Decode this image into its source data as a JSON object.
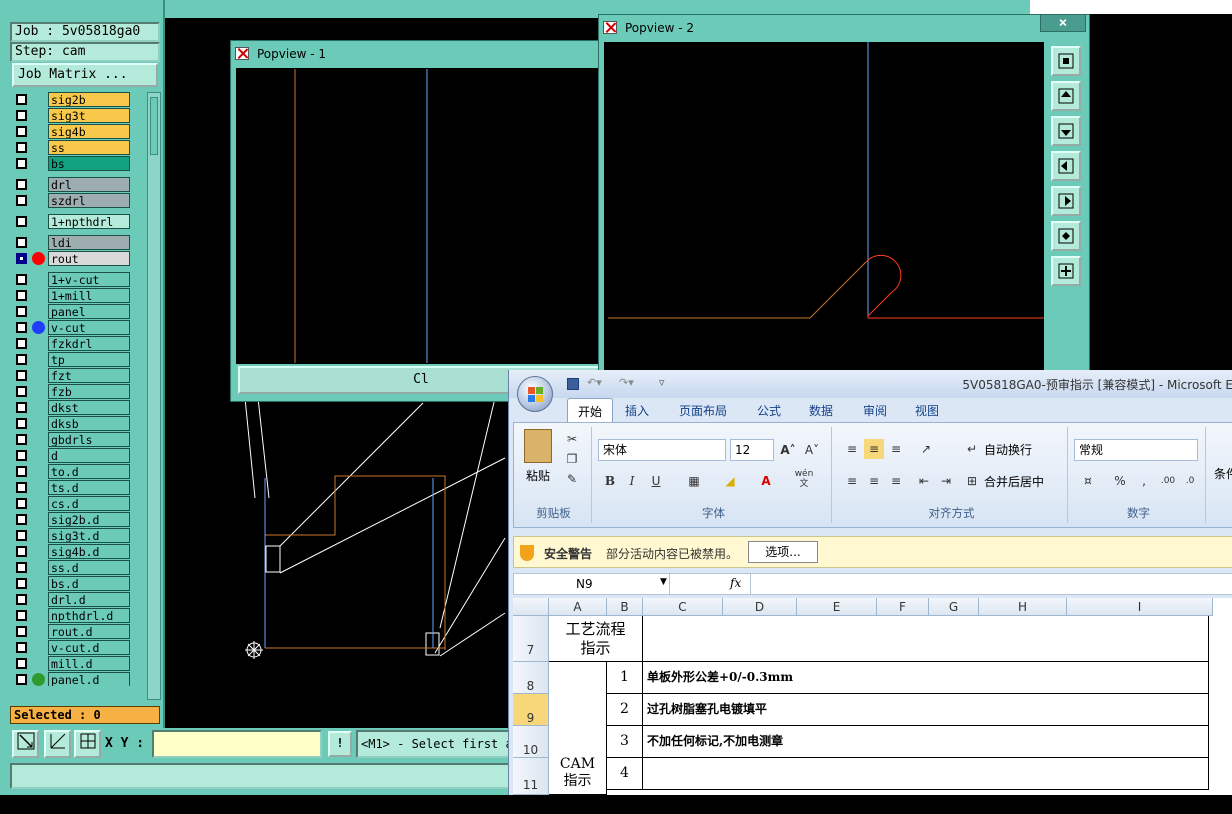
{
  "cam": {
    "job_label": "Job : 5v05818ga0",
    "step_label": "Step: cam",
    "job_matrix_button": "Job Matrix ...",
    "layers": [
      {
        "name": "sig2b",
        "color": "#f7c84a",
        "check": "white",
        "dot": ""
      },
      {
        "name": "sig3t",
        "color": "#f7c84a",
        "check": "white",
        "dot": ""
      },
      {
        "name": "sig4b",
        "color": "#f7c84a",
        "check": "white",
        "dot": ""
      },
      {
        "name": "ss",
        "color": "#f7c84a",
        "check": "white",
        "dot": ""
      },
      {
        "name": "bs",
        "color": "#12a27f",
        "check": "white",
        "dot": ""
      },
      {
        "name": "drl",
        "color": "#9dadb0",
        "check": "white",
        "dot": ""
      },
      {
        "name": "szdrl",
        "color": "#9dadb0",
        "check": "white",
        "dot": ""
      },
      {
        "name": "1+npthdrl",
        "color": "#b4ead9",
        "check": "white",
        "dot": ""
      },
      {
        "name": "ldi",
        "color": "#9dadb0",
        "check": "white",
        "dot": ""
      },
      {
        "name": "rout",
        "color": "#d9d9d9",
        "check": "blue",
        "dot": "#ff0000"
      },
      {
        "name": "1+v-cut",
        "color": "#6bcbb8",
        "check": "white",
        "dot": ""
      },
      {
        "name": "1+mill",
        "color": "#6bcbb8",
        "check": "white",
        "dot": ""
      },
      {
        "name": "panel",
        "color": "#6bcbb8",
        "check": "white",
        "dot": ""
      },
      {
        "name": "v-cut",
        "color": "#6bcbb8",
        "check": "white",
        "dot": "#1f3cff"
      },
      {
        "name": "fzkdrl",
        "color": "#6bcbb8",
        "check": "white",
        "dot": ""
      },
      {
        "name": "tp",
        "color": "#6bcbb8",
        "check": "white",
        "dot": ""
      },
      {
        "name": "fzt",
        "color": "#6bcbb8",
        "check": "white",
        "dot": ""
      },
      {
        "name": "fzb",
        "color": "#6bcbb8",
        "check": "white",
        "dot": ""
      },
      {
        "name": "dkst",
        "color": "#6bcbb8",
        "check": "white",
        "dot": ""
      },
      {
        "name": "dksb",
        "color": "#6bcbb8",
        "check": "white",
        "dot": ""
      },
      {
        "name": "gbdrls",
        "color": "#6bcbb8",
        "check": "white",
        "dot": ""
      },
      {
        "name": "d",
        "color": "#6bcbb8",
        "check": "white",
        "dot": ""
      },
      {
        "name": "to.d",
        "color": "#6bcbb8",
        "check": "white",
        "dot": ""
      },
      {
        "name": "ts.d",
        "color": "#6bcbb8",
        "check": "white",
        "dot": ""
      },
      {
        "name": "cs.d",
        "color": "#6bcbb8",
        "check": "white",
        "dot": ""
      },
      {
        "name": "sig2b.d",
        "color": "#6bcbb8",
        "check": "white",
        "dot": ""
      },
      {
        "name": "sig3t.d",
        "color": "#6bcbb8",
        "check": "white",
        "dot": ""
      },
      {
        "name": "sig4b.d",
        "color": "#6bcbb8",
        "check": "white",
        "dot": ""
      },
      {
        "name": "ss.d",
        "color": "#6bcbb8",
        "check": "white",
        "dot": ""
      },
      {
        "name": "bs.d",
        "color": "#6bcbb8",
        "check": "white",
        "dot": ""
      },
      {
        "name": "drl.d",
        "color": "#6bcbb8",
        "check": "white",
        "dot": ""
      },
      {
        "name": "npthdrl.d",
        "color": "#6bcbb8",
        "check": "white",
        "dot": ""
      },
      {
        "name": "rout.d",
        "color": "#6bcbb8",
        "check": "white",
        "dot": ""
      },
      {
        "name": "v-cut.d",
        "color": "#6bcbb8",
        "check": "white",
        "dot": ""
      },
      {
        "name": "mill.d",
        "color": "#6bcbb8",
        "check": "white",
        "dot": ""
      },
      {
        "name": "panel.d",
        "color": "#6bcbb8",
        "check": "white",
        "dot": "#2e9a2e"
      }
    ],
    "selected_label": "Selected : 0",
    "xy_label": "X Y :",
    "xy_value": "",
    "exclaim_button": "!",
    "status_message": "<M1> - Select first a",
    "popview1_title": "Popview - 1",
    "popview1_button": "Cl",
    "popview2_title": "Popview - 2",
    "popview2_close": "×"
  },
  "excel": {
    "title": "5V05818GA0-预审指示 [兼容模式] - Microsoft E",
    "tabs": [
      "开始",
      "插入",
      "页面布局",
      "公式",
      "数据",
      "审阅",
      "视图"
    ],
    "clipboard": {
      "paste": "粘贴",
      "group": "剪贴板"
    },
    "font": {
      "name": "宋体",
      "size": "12",
      "bold": "B",
      "italic": "I",
      "underline": "U",
      "wen": "wén\n文",
      "group": "字体"
    },
    "alignment": {
      "wrap": "自动换行",
      "merge": "合并后居中",
      "group": "对齐方式"
    },
    "number": {
      "format": "常规",
      "percent": "%",
      "comma": ",",
      "inc": ".00",
      "group": "数字"
    },
    "styles": {
      "cond": "条件格"
    },
    "security": {
      "title": "安全警告",
      "text": "部分活动内容已被禁用。",
      "button": "选项..."
    },
    "name_box": "N9",
    "fx": "fx",
    "columns": [
      "A",
      "B",
      "C",
      "D",
      "E",
      "F",
      "G",
      "H",
      "I"
    ],
    "rows": [
      "7",
      "8",
      "9",
      "10",
      "11"
    ],
    "cell_a7": "工艺流程\n指示",
    "cell_a_cam": "CAM\n指示",
    "items": [
      {
        "no": "1",
        "text": "单板外形公差+0/-0.3mm"
      },
      {
        "no": "2",
        "text": "过孔树脂塞孔电镀填平"
      },
      {
        "no": "3",
        "text": "不加任何标记,不加电测章"
      },
      {
        "no": "4",
        "text": ""
      }
    ]
  },
  "icons": {
    "ribbon_cut": "scissors-icon",
    "ribbon_copy": "copy-icon",
    "ribbon_format_painter": "brush-icon"
  }
}
